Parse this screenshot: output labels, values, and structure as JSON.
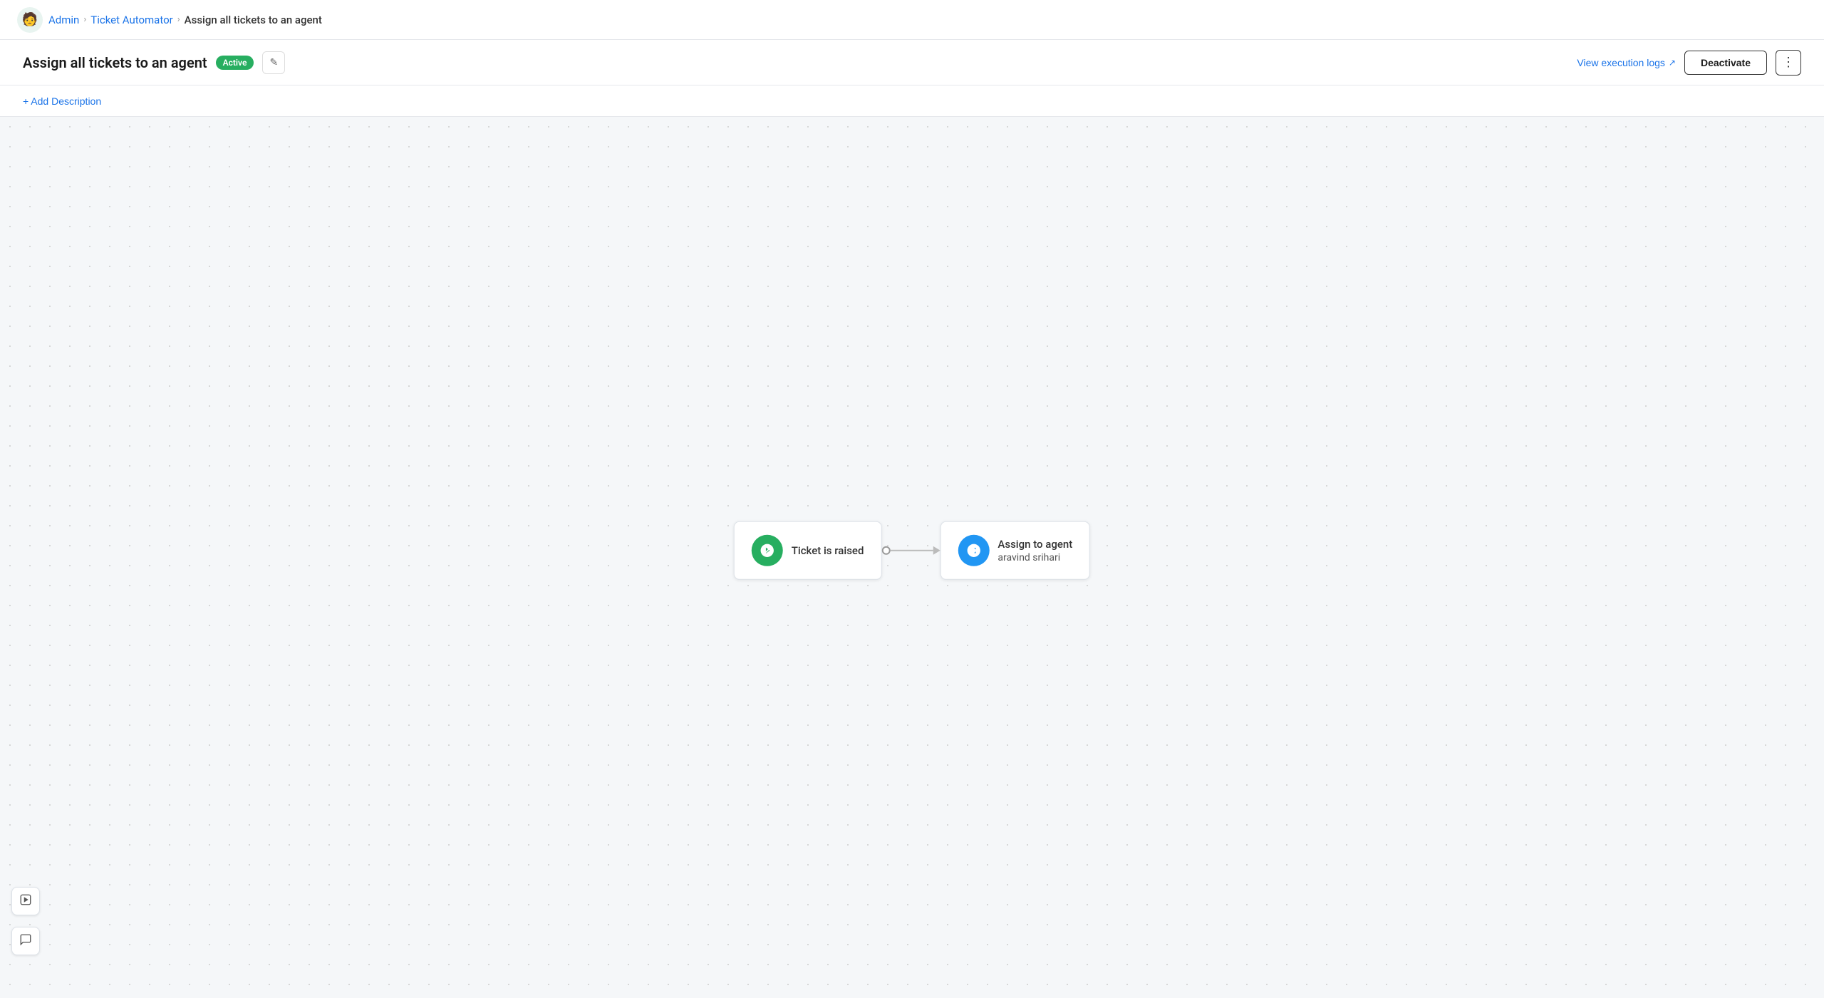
{
  "nav": {
    "admin_label": "Admin",
    "automator_label": "Ticket Automator",
    "current_label": "Assign all tickets to an agent"
  },
  "header": {
    "title": "Assign all tickets to an agent",
    "status": "Active",
    "view_logs_label": "View execution logs",
    "deactivate_label": "Deactivate"
  },
  "sub_header": {
    "add_desc_label": "+ Add Description"
  },
  "flow": {
    "trigger_node": {
      "label": "Ticket is raised"
    },
    "action_node": {
      "line1": "Assign to agent",
      "line2": "aravind srihari"
    }
  },
  "toolbar": {
    "run_icon": "▶",
    "chat_icon": "💬"
  }
}
